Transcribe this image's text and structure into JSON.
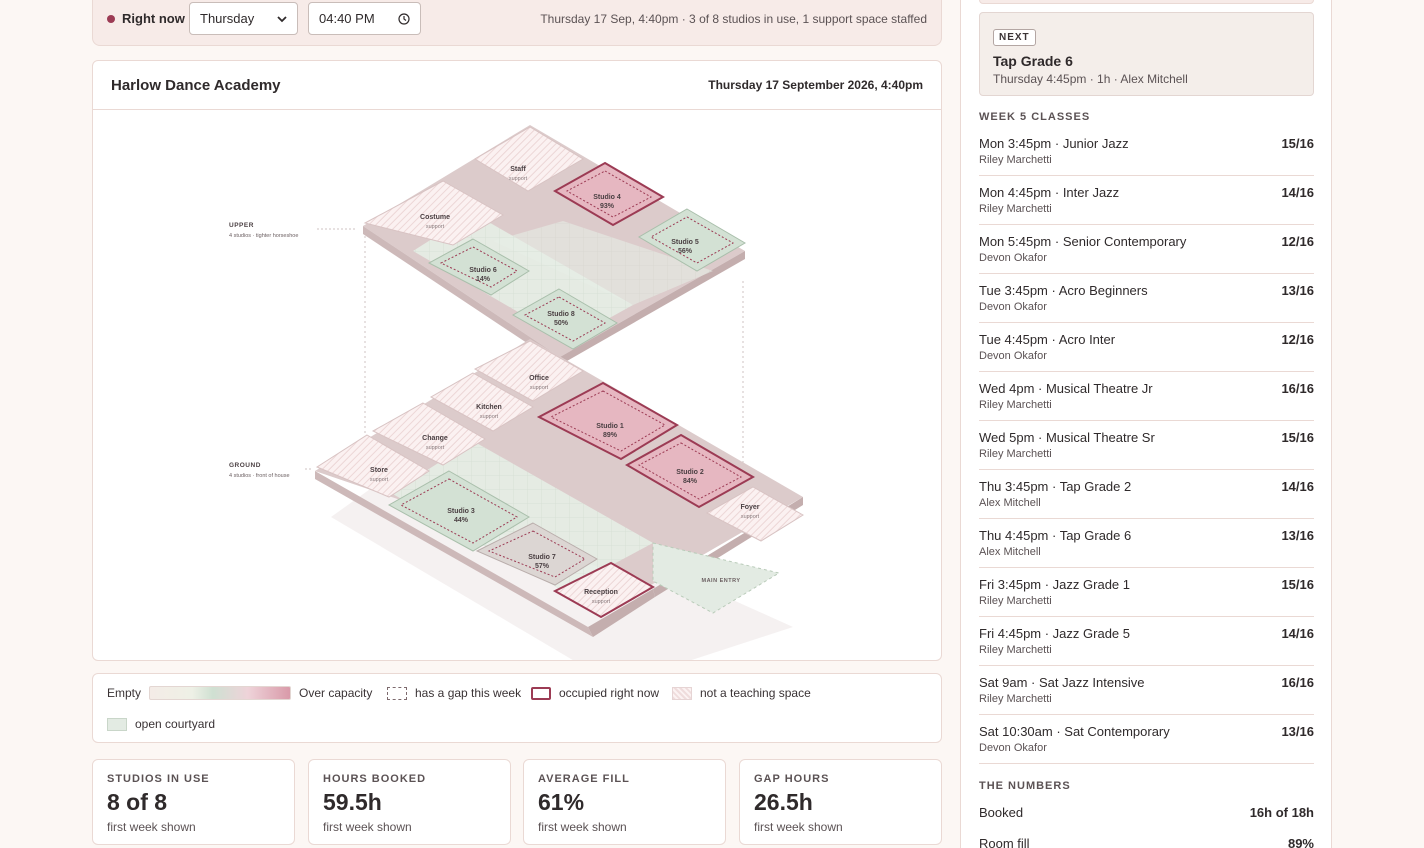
{
  "controls": {
    "live_label": "Right now",
    "day": "Thursday",
    "time": "04:40 PM",
    "summary": "Thursday 17 Sep, 4:40pm · 3 of 8 studios in use, 1 support space staffed"
  },
  "map": {
    "title": "Harlow Dance Academy",
    "datetime": "Thursday 17 September 2026, 4:40pm",
    "floors": {
      "upper": {
        "name": "UPPER",
        "desc": "4 studios · tighter horseshoe"
      },
      "ground": {
        "name": "GROUND",
        "desc": "4 studios · front of house"
      }
    },
    "entry_label": "MAIN ENTRY",
    "support_word": "support",
    "rooms": {
      "staff": "Staff",
      "costume": "Costume",
      "office": "Office",
      "kitchen": "Kitchen",
      "change": "Change",
      "store": "Store",
      "foyer": "Foyer",
      "reception": "Reception",
      "studio1": {
        "name": "Studio 1",
        "fill": "89%"
      },
      "studio2": {
        "name": "Studio 2",
        "fill": "84%"
      },
      "studio3": {
        "name": "Studio 3",
        "fill": "44%"
      },
      "studio4": {
        "name": "Studio 4",
        "fill": "93%"
      },
      "studio5": {
        "name": "Studio 5",
        "fill": "56%"
      },
      "studio6": {
        "name": "Studio 6",
        "fill": "14%"
      },
      "studio7": {
        "name": "Studio 7",
        "fill": "57%"
      },
      "studio8": {
        "name": "Studio 8",
        "fill": "50%"
      }
    }
  },
  "legend": {
    "empty": "Empty",
    "over": "Over capacity",
    "gap": "has a gap this week",
    "occupied": "occupied right now",
    "not_teaching": "not a teaching space",
    "courtyard": "open courtyard"
  },
  "stats": [
    {
      "label": "STUDIOS IN USE",
      "value": "8 of 8",
      "sub": "first week shown"
    },
    {
      "label": "HOURS BOOKED",
      "value": "59.5h",
      "sub": "first week shown"
    },
    {
      "label": "AVERAGE FILL",
      "value": "61%",
      "sub": "first week shown"
    },
    {
      "label": "GAP HOURS",
      "value": "26.5h",
      "sub": "first week shown"
    }
  ],
  "sidebar": {
    "next": {
      "badge": "NEXT",
      "title": "Tap Grade 6",
      "meta": "Thursday 4:45pm · 1h · Alex Mitchell"
    },
    "week_heading": "WEEK 5 CLASSES",
    "classes": [
      {
        "name": "Mon 3:45pm · Junior Jazz",
        "teacher": "Riley Marchetti",
        "fill": "15/16"
      },
      {
        "name": "Mon 4:45pm · Inter Jazz",
        "teacher": "Riley Marchetti",
        "fill": "14/16"
      },
      {
        "name": "Mon 5:45pm · Senior Contemporary",
        "teacher": "Devon Okafor",
        "fill": "12/16"
      },
      {
        "name": "Tue 3:45pm · Acro Beginners",
        "teacher": "Devon Okafor",
        "fill": "13/16"
      },
      {
        "name": "Tue 4:45pm · Acro Inter",
        "teacher": "Devon Okafor",
        "fill": "12/16"
      },
      {
        "name": "Wed 4pm · Musical Theatre Jr",
        "teacher": "Riley Marchetti",
        "fill": "16/16"
      },
      {
        "name": "Wed 5pm · Musical Theatre Sr",
        "teacher": "Riley Marchetti",
        "fill": "15/16"
      },
      {
        "name": "Thu 3:45pm · Tap Grade 2",
        "teacher": "Alex Mitchell",
        "fill": "14/16"
      },
      {
        "name": "Thu 4:45pm · Tap Grade 6",
        "teacher": "Alex Mitchell",
        "fill": "13/16"
      },
      {
        "name": "Fri 3:45pm · Jazz Grade 1",
        "teacher": "Riley Marchetti",
        "fill": "15/16"
      },
      {
        "name": "Fri 4:45pm · Jazz Grade 5",
        "teacher": "Riley Marchetti",
        "fill": "14/16"
      },
      {
        "name": "Sat 9am · Sat Jazz Intensive",
        "teacher": "Riley Marchetti",
        "fill": "16/16"
      },
      {
        "name": "Sat 10:30am · Sat Contemporary",
        "teacher": "Devon Okafor",
        "fill": "13/16"
      }
    ],
    "numbers_heading": "THE NUMBERS",
    "numbers": [
      {
        "label": "Booked",
        "value": "16h of 18h"
      },
      {
        "label": "Room fill",
        "value": "89%"
      }
    ]
  },
  "colors": {
    "accent": "#9c3b54",
    "studio_hot": "#e6b7c1",
    "studio_cool": "#d3e1d4",
    "support_hatch": "#efdcdc",
    "courtyard": "#e3ebe3"
  }
}
